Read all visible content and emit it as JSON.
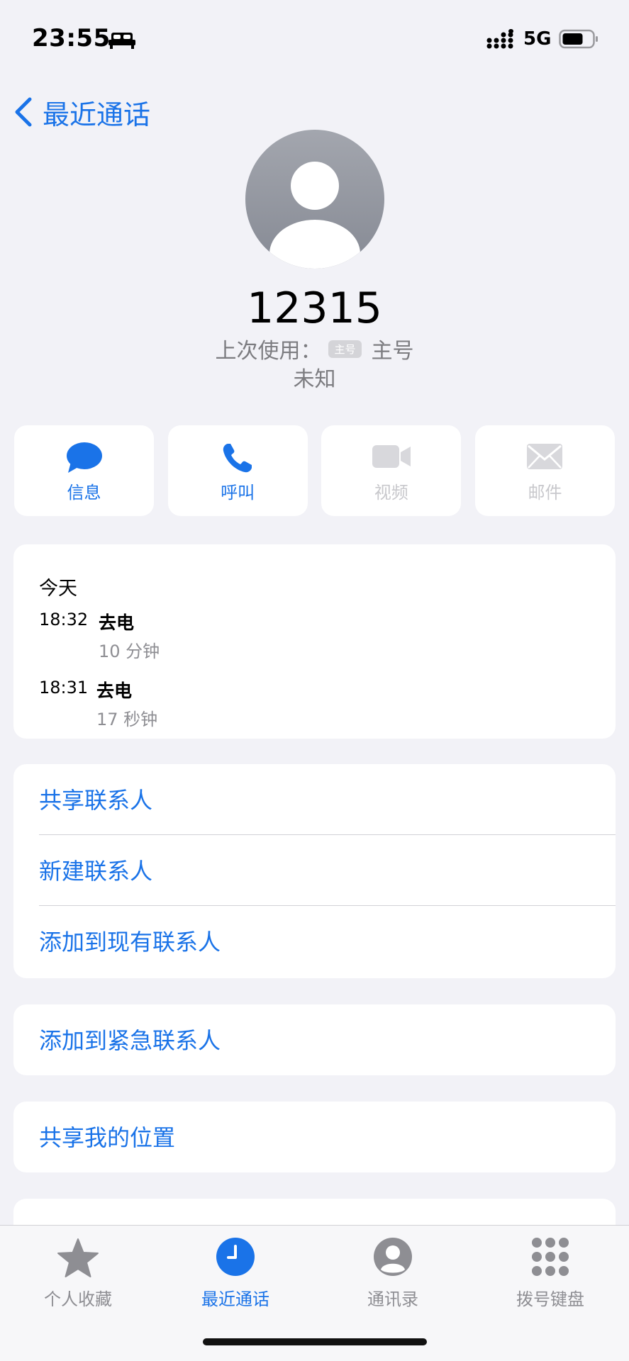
{
  "status_bar": {
    "time": "23:55",
    "network": "5G"
  },
  "nav": {
    "back_label": "最近通话"
  },
  "contact": {
    "number": "12315",
    "last_used_label": "上次使用：",
    "last_used_tag": "主号",
    "last_used_value": "主号",
    "location": "未知"
  },
  "actions": [
    {
      "label": "信息",
      "icon": "message-icon",
      "enabled": true
    },
    {
      "label": "呼叫",
      "icon": "phone-icon",
      "enabled": true
    },
    {
      "label": "视频",
      "icon": "video-icon",
      "enabled": false
    },
    {
      "label": "邮件",
      "icon": "mail-icon",
      "enabled": false
    }
  ],
  "history": {
    "day": "今天",
    "entries": [
      {
        "time": "18:32",
        "type": "去电",
        "duration": "10 分钟"
      },
      {
        "time": "18:31",
        "type": "去电",
        "duration": "17 秒钟"
      }
    ]
  },
  "options_group1": [
    "共享联系人",
    "新建联系人",
    "添加到现有联系人"
  ],
  "options_group2": [
    "添加到紧急联系人"
  ],
  "options_group3": [
    "共享我的位置"
  ],
  "tabbar": {
    "items": [
      {
        "label": "个人收藏",
        "icon": "star-icon",
        "active": false
      },
      {
        "label": "最近通话",
        "icon": "clock-icon",
        "active": true
      },
      {
        "label": "通讯录",
        "icon": "person-icon",
        "active": false
      },
      {
        "label": "拨号键盘",
        "icon": "keypad-icon",
        "active": false
      }
    ]
  },
  "colors": {
    "accent": "#1a73e8",
    "background": "#f2f2f7",
    "card": "#ffffff",
    "disabled": "#c8c8cc"
  }
}
